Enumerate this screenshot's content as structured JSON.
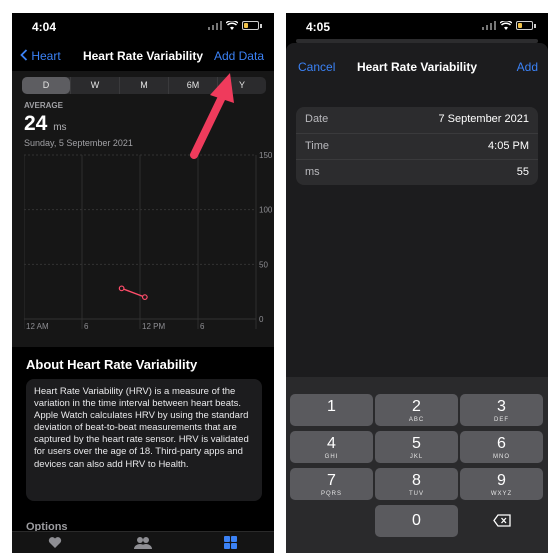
{
  "left": {
    "status_time": "4:04",
    "nav": {
      "back": "Heart",
      "title": "Heart Rate Variability",
      "action": "Add Data"
    },
    "ranges": [
      "D",
      "W",
      "M",
      "6M",
      "Y"
    ],
    "selected_range": "D",
    "average_label": "AVERAGE",
    "average_value": "24",
    "average_unit": "ms",
    "date": "Sunday, 5 September 2021",
    "about_title": "About Heart Rate Variability",
    "about_text": "Heart Rate Variability (HRV) is a measure of the variation in the time interval between heart beats. Apple Watch calculates HRV by using the standard deviation of beat-to-beat measurements that are captured by the heart rate sensor. HRV is validated for users over the age of 18. Third-party apps and devices can also add HRV to Health.",
    "more_label": "Options",
    "tabs": [
      "heart-icon",
      "people-icon",
      "grid-icon"
    ],
    "colors": {
      "accent": "#3b82f6",
      "series": "#ff4d6a",
      "arrow": "#ef3b5c"
    }
  },
  "chart_data": {
    "type": "line",
    "x_ticks": [
      "12 AM",
      "6",
      "12 PM",
      "6"
    ],
    "y_ticks": [
      0,
      50,
      100,
      150
    ],
    "ylim": [
      0,
      150
    ],
    "xlim_hours": [
      0,
      24
    ],
    "series": [
      {
        "values": [
          {
            "x": 10.1,
            "y": 28
          },
          {
            "x": 12.5,
            "y": 20
          }
        ]
      }
    ],
    "grid": true
  },
  "right": {
    "status_time": "4:05",
    "nav": {
      "cancel": "Cancel",
      "title": "Heart Rate Variability",
      "add": "Add"
    },
    "fields": [
      {
        "key": "Date",
        "value": "7 September 2021"
      },
      {
        "key": "Time",
        "value": "4:05 PM"
      },
      {
        "key": "ms",
        "value": "55"
      }
    ],
    "keypad": [
      {
        "digit": "1",
        "letters": ""
      },
      {
        "digit": "2",
        "letters": "ABC"
      },
      {
        "digit": "3",
        "letters": "DEF"
      },
      {
        "digit": "4",
        "letters": "GHI"
      },
      {
        "digit": "5",
        "letters": "JKL"
      },
      {
        "digit": "6",
        "letters": "MNO"
      },
      {
        "digit": "7",
        "letters": "PQRS"
      },
      {
        "digit": "8",
        "letters": "TUV"
      },
      {
        "digit": "9",
        "letters": "WXYZ"
      },
      {
        "digit": "0",
        "letters": ""
      }
    ],
    "backspace_icon": "backspace-icon"
  }
}
